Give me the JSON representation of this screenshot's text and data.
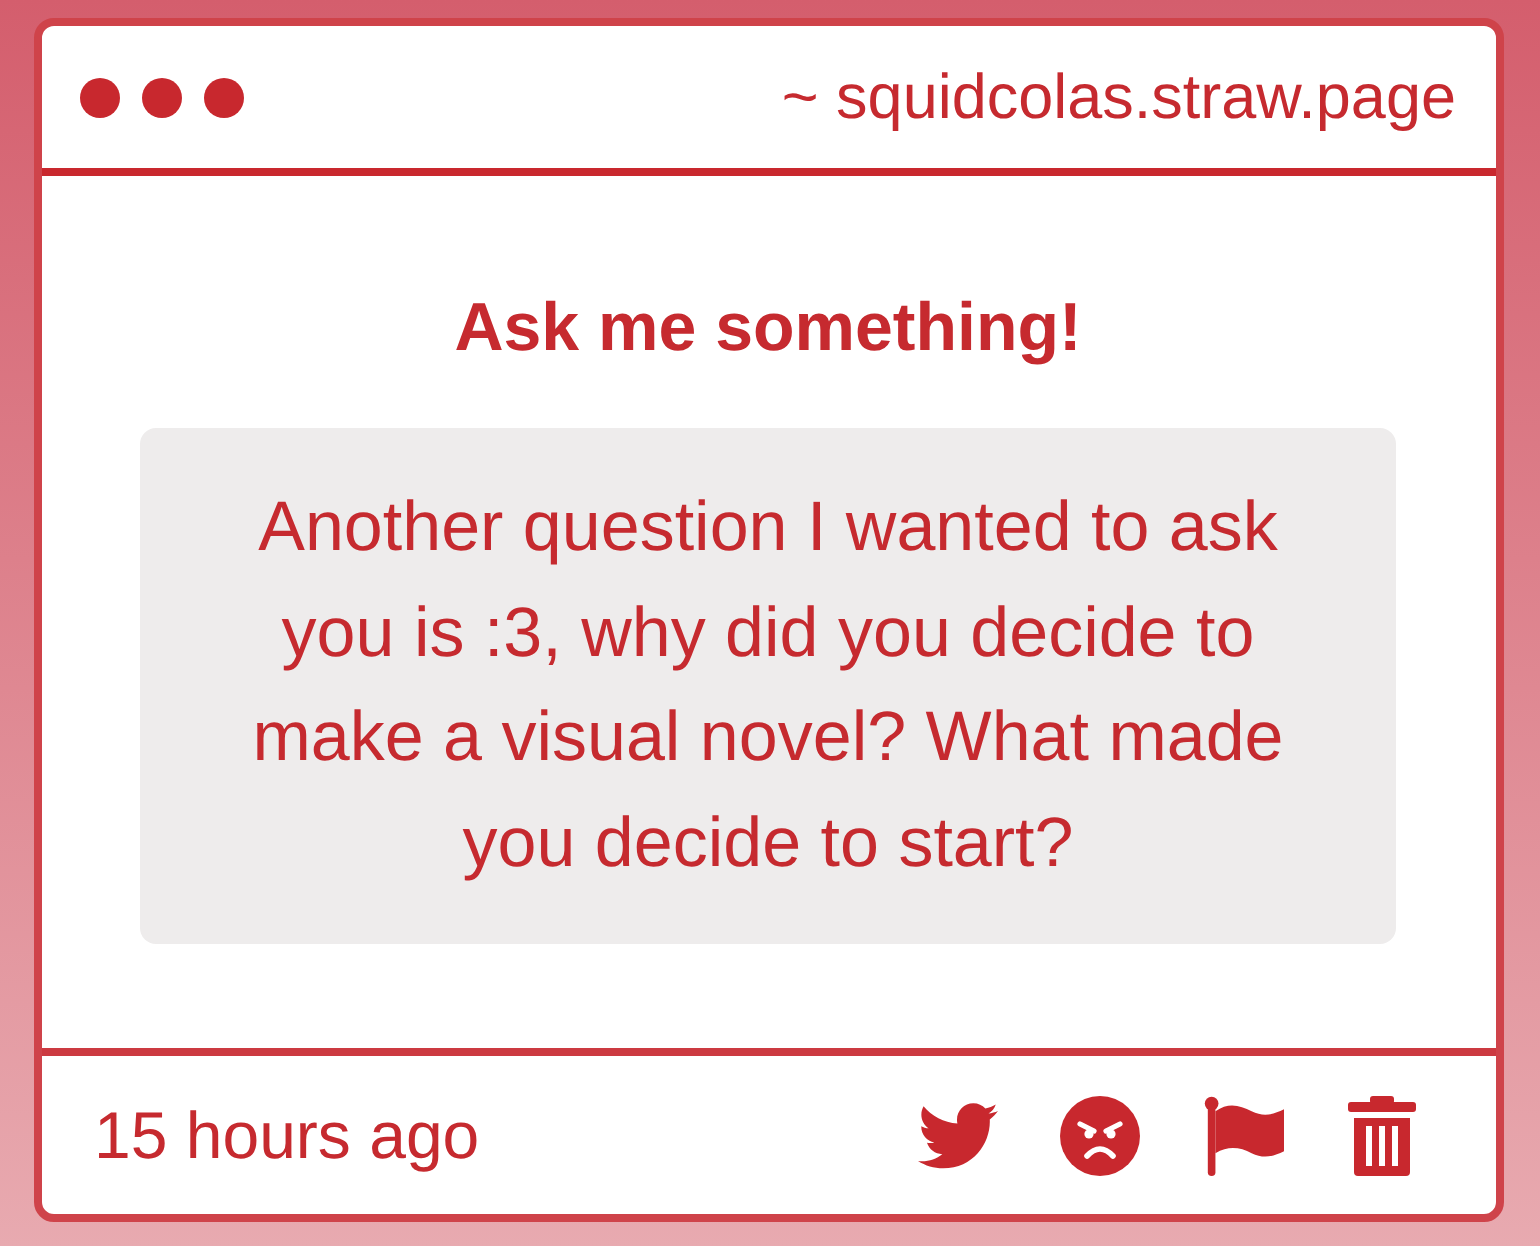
{
  "window": {
    "url": "~ squidcolas.straw.page"
  },
  "prompt": {
    "title": "Ask me something!"
  },
  "question": {
    "text": "Another question I wanted to ask you is :3, why did you decide to make a visual novel? What made you decide to start?"
  },
  "footer": {
    "time": "15 hours ago",
    "actions": [
      {
        "kind": "bird"
      },
      {
        "kind": "angry"
      },
      {
        "kind": "flag"
      },
      {
        "kind": "trash"
      }
    ]
  }
}
